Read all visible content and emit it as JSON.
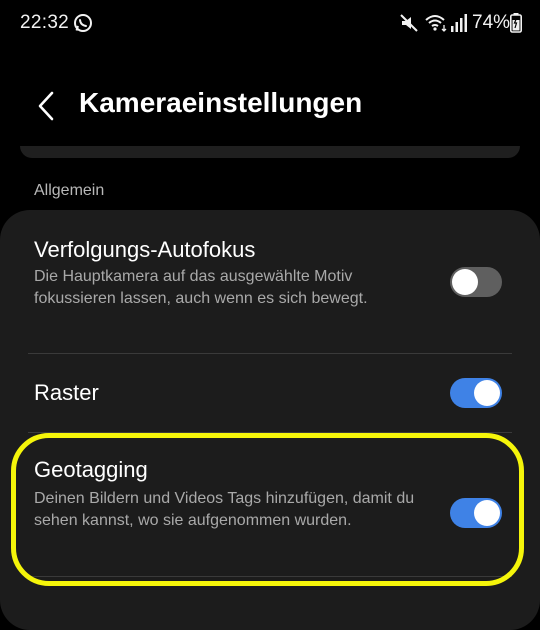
{
  "status_bar": {
    "time": "22:32",
    "battery": "74%",
    "icons": [
      "whatsapp-icon",
      "mute-icon",
      "wifi-icon",
      "signal-icon",
      "battery-icon"
    ]
  },
  "header": {
    "back_icon": "chevron-left-icon",
    "title": "Kameraeinstellungen"
  },
  "section": {
    "label": "Allgemein"
  },
  "settings": [
    {
      "title": "Verfolgungs-Autofokus",
      "description": "Die Hauptkamera auf das ausgewählte Motiv fokussieren lassen, auch wenn es sich bewegt.",
      "enabled": false
    },
    {
      "title": "Raster",
      "description": "",
      "enabled": true
    },
    {
      "title": "Geotagging",
      "description": "Deinen Bildern und Videos Tags hinzufügen, damit du sehen kannst, wo sie aufgenommen wurden.",
      "enabled": true
    }
  ],
  "colors": {
    "background": "#000000",
    "card": "#1c1c1c",
    "toggle_on": "#3f82e6",
    "toggle_off": "#5f5f5f",
    "highlight": "#f5f50a"
  }
}
